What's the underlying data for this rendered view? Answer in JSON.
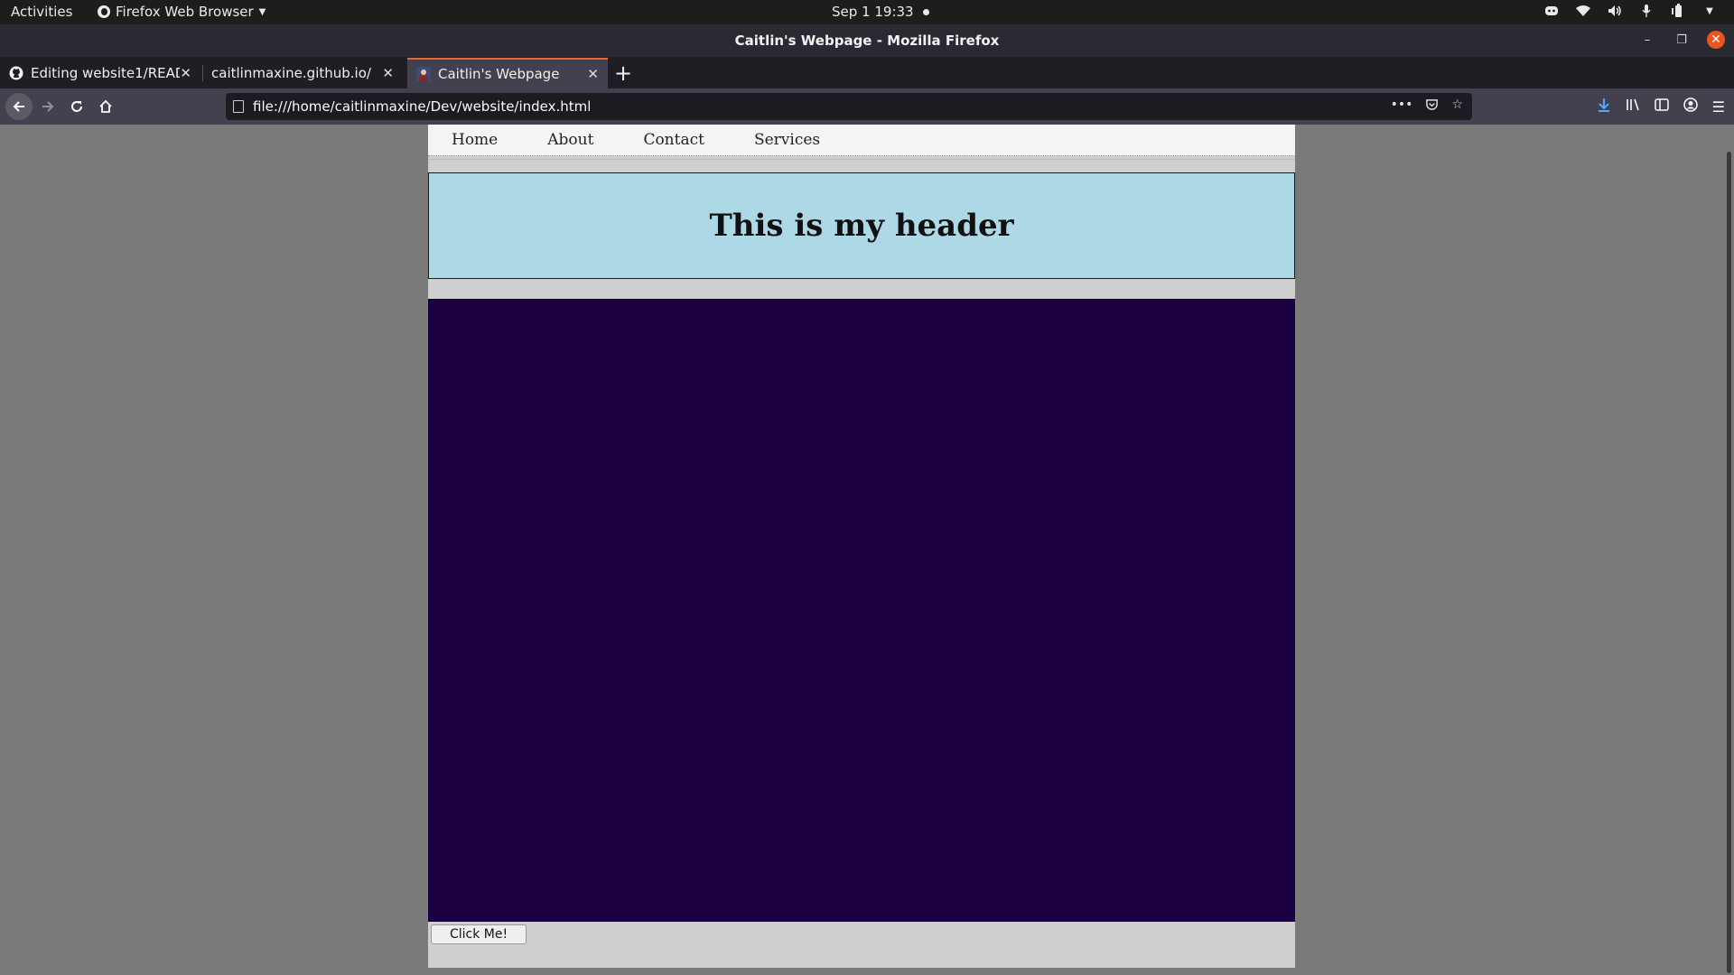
{
  "os": {
    "activities": "Activities",
    "app_menu": "Firefox Web Browser",
    "clock": "Sep 1  19:33"
  },
  "window": {
    "title": "Caitlin's Webpage - Mozilla Firefox"
  },
  "tabs": [
    {
      "label": "Editing website1/READM",
      "icon": "github-icon",
      "active": false
    },
    {
      "label": "caitlinmaxine.github.io/",
      "icon": "none",
      "active": false
    },
    {
      "label": "Caitlin's Webpage",
      "icon": "page-favicon-icon",
      "active": true
    }
  ],
  "url": "file:///home/caitlinmaxine/Dev/website/index.html",
  "site": {
    "nav": [
      "Home",
      "About",
      "Contact",
      "Services"
    ],
    "header": "This is my header",
    "button": "Click Me!",
    "colors": {
      "header_bg": "#add8e6",
      "main_bg": "#1a0040",
      "page_bg": "#cfcfcf"
    }
  },
  "colors": {
    "accent": "#e66b32",
    "close_button": "#e95420"
  }
}
